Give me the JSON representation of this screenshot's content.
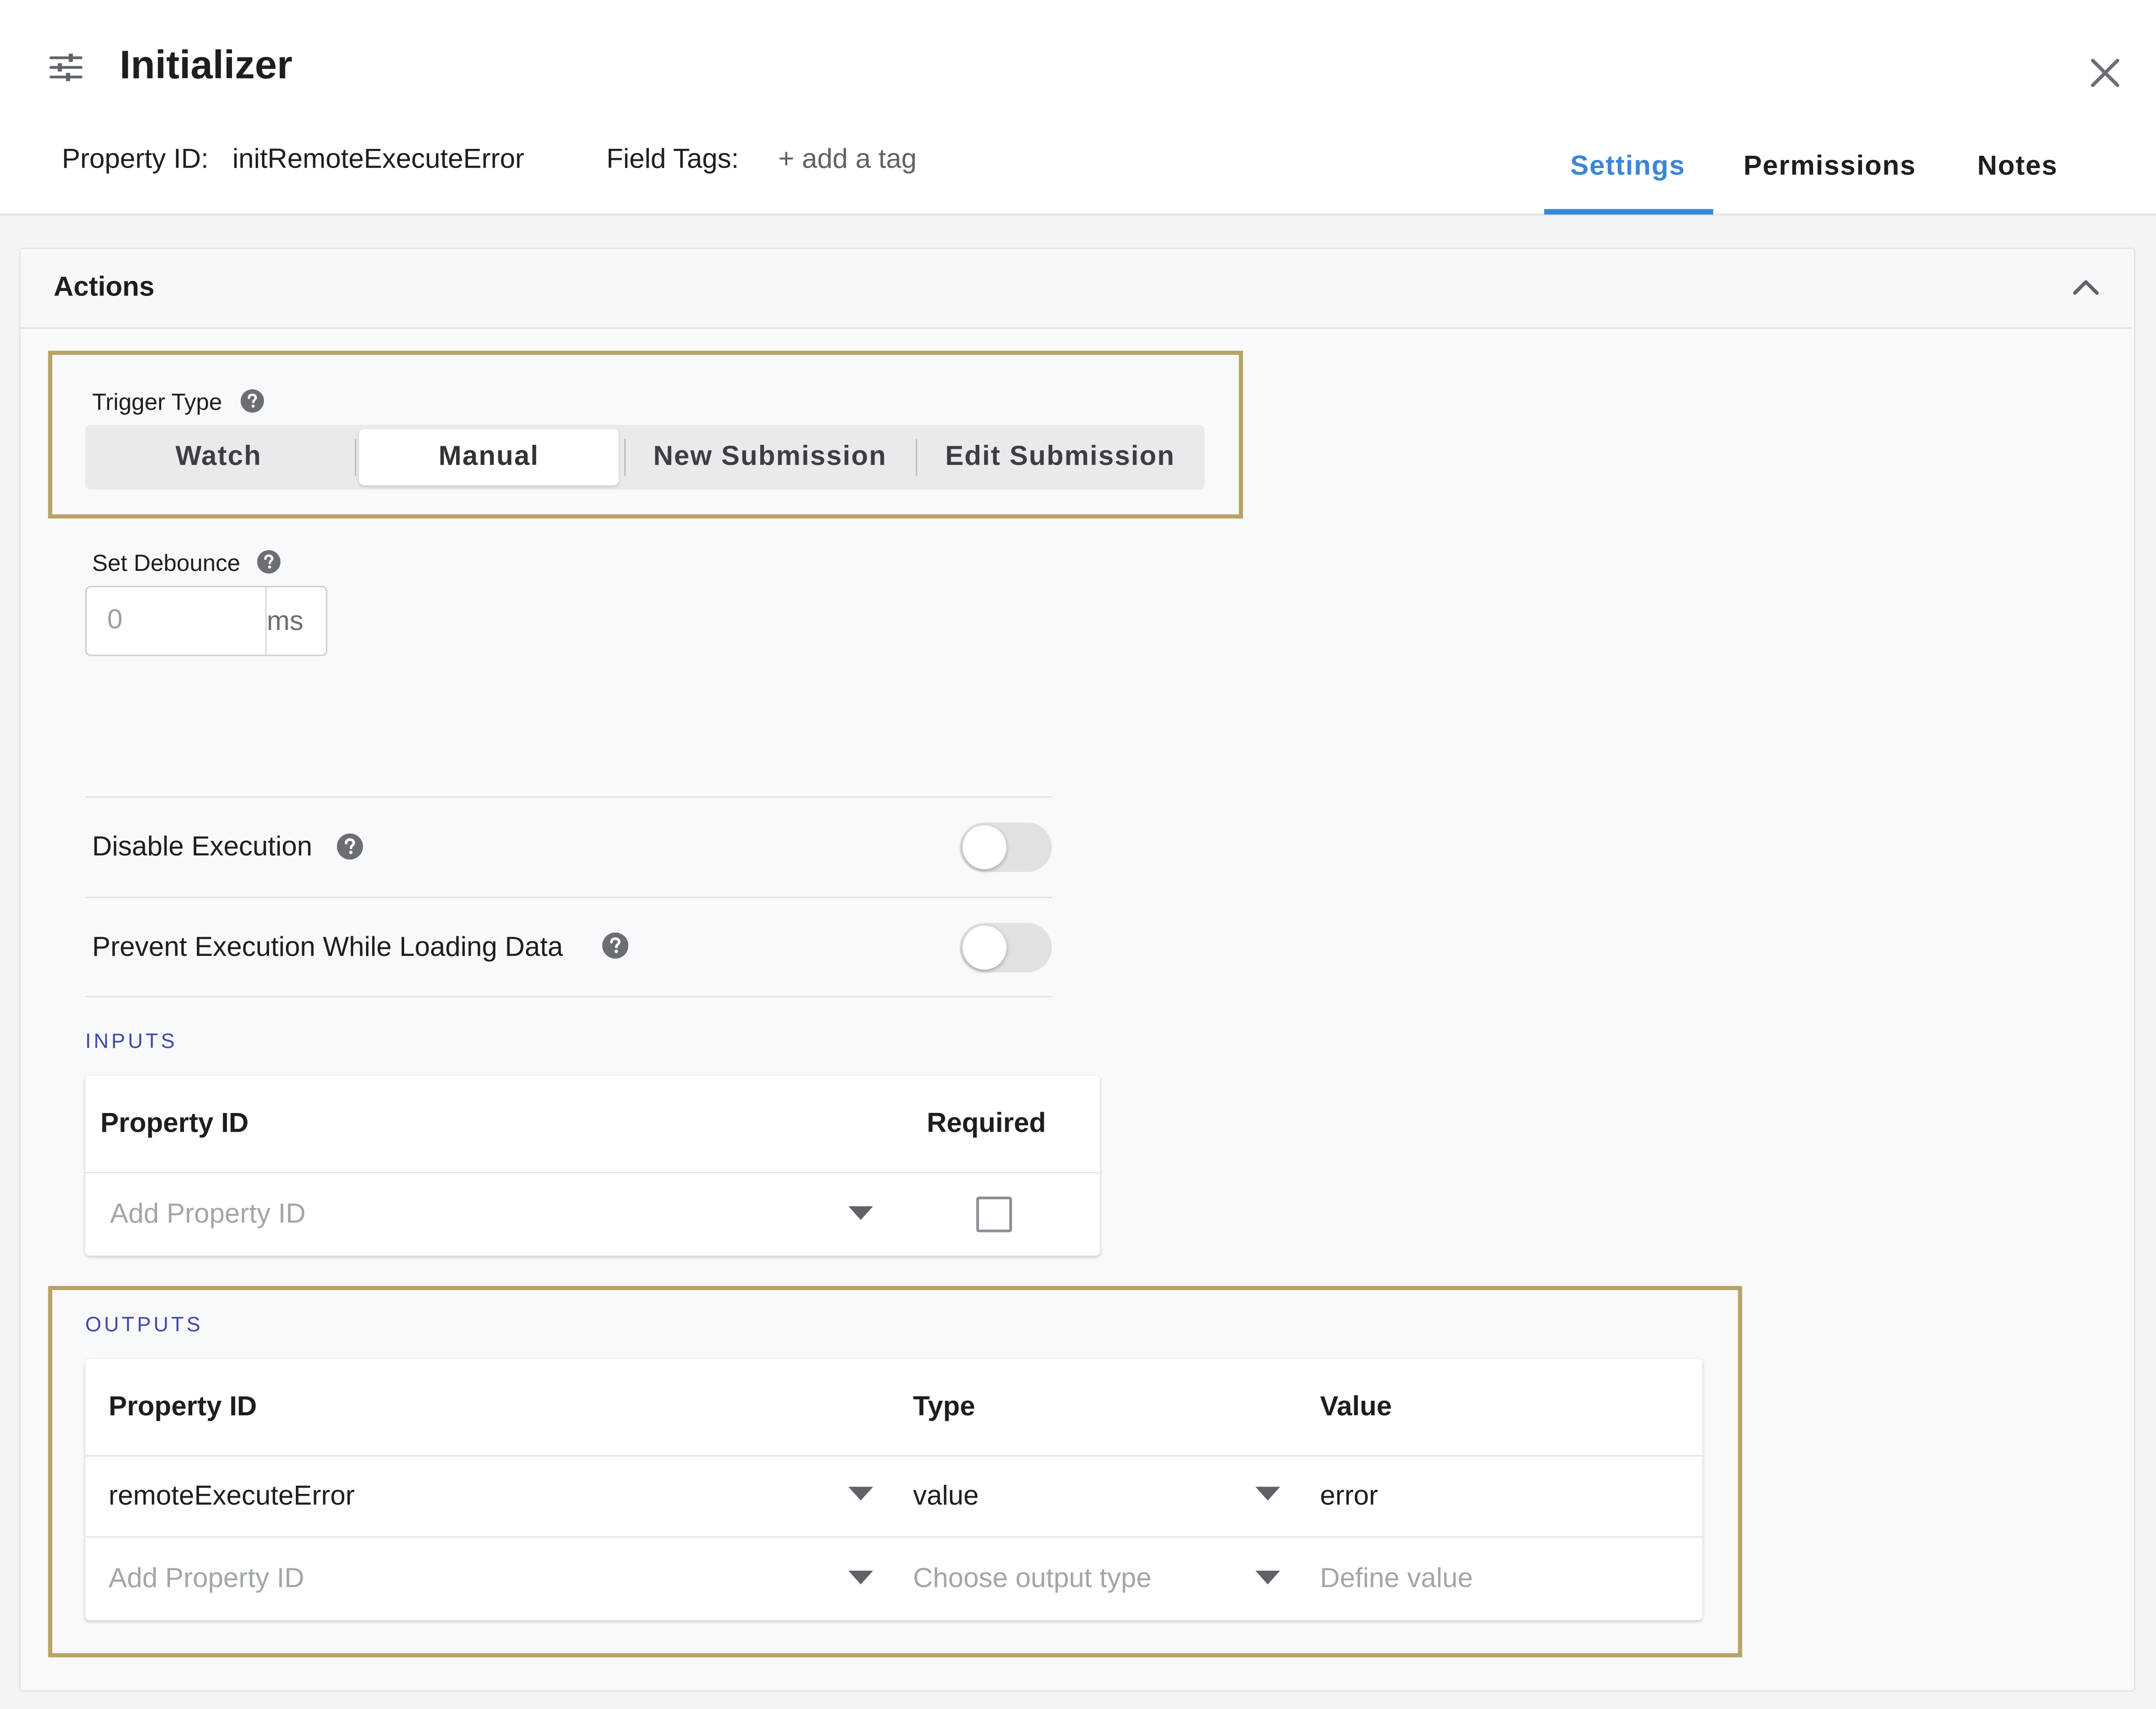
{
  "header": {
    "title": "Initializer",
    "property_id_label": "Property ID:",
    "property_id_value": "initRemoteExecuteError",
    "field_tags_label": "Field Tags:",
    "add_tag_label": "+ add a tag",
    "tabs": [
      {
        "label": "Settings",
        "active": true
      },
      {
        "label": "Permissions",
        "active": false
      },
      {
        "label": "Notes",
        "active": false
      }
    ]
  },
  "actions": {
    "title": "Actions",
    "trigger_type": {
      "label": "Trigger Type",
      "options": [
        "Watch",
        "Manual",
        "New Submission",
        "Edit Submission"
      ],
      "selected": "Manual"
    },
    "debounce": {
      "label": "Set Debounce",
      "placeholder": "0",
      "unit": "ms"
    },
    "toggles": [
      {
        "label": "Disable Execution",
        "on": false
      },
      {
        "label": "Prevent Execution While Loading Data",
        "on": false
      }
    ]
  },
  "inputs": {
    "heading": "INPUTS",
    "columns": [
      "Property ID",
      "Required"
    ],
    "rows": [
      {
        "property_placeholder": "Add Property ID",
        "required": false
      }
    ]
  },
  "outputs": {
    "heading": "OUTPUTS",
    "columns": [
      "Property ID",
      "Type",
      "Value"
    ],
    "rows": [
      {
        "property": "remoteExecuteError",
        "type": "value",
        "value": "error"
      },
      {
        "property": "Add Property ID",
        "type": "Choose output type",
        "value": "Define value"
      }
    ]
  },
  "colors": {
    "accent": "#3b86d6",
    "highlight_border": "#b8a264",
    "section_heading": "#3d49a8"
  }
}
